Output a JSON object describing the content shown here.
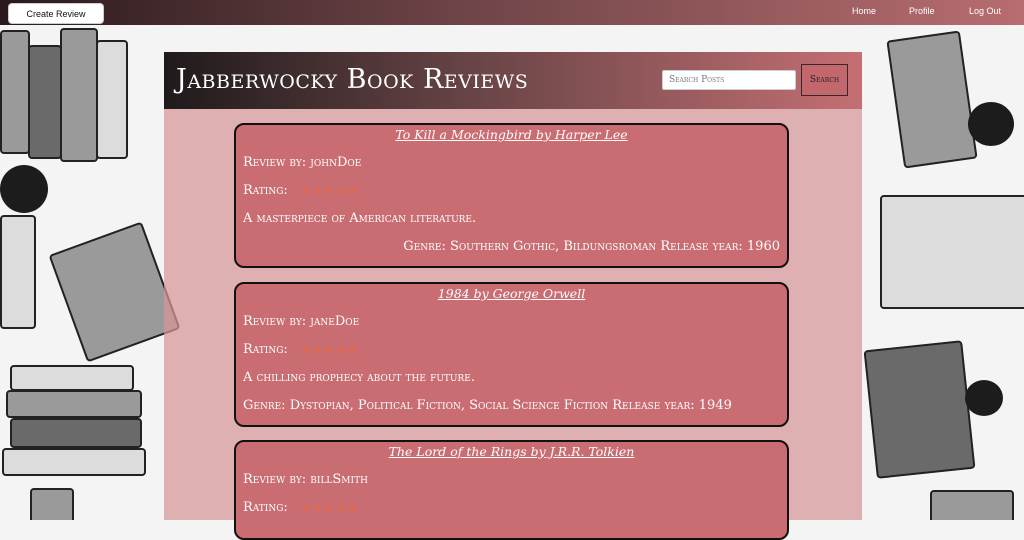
{
  "nav": {
    "create_label": "Create Review",
    "home_label": "Home",
    "profile_label": "Profile",
    "logout_label": "Log Out"
  },
  "header": {
    "title": "Jabberwocky Book Reviews",
    "search_placeholder": "Search Posts",
    "search_button": "Search"
  },
  "reviews": [
    {
      "title": "To Kill a Mockingbird by Harper Lee",
      "reviewer": "Review by: johnDoe",
      "rating_label": "Rating:",
      "stars": "★★★★★",
      "rating": 5,
      "body": "A masterpiece of American literature.",
      "footer": "Genre: Southern Gothic, Bildungsroman Release year: 1960"
    },
    {
      "title": "1984 by George Orwell",
      "reviewer": "Review by: janeDoe",
      "rating_label": "Rating:",
      "stars": "★★★★★",
      "rating": 5,
      "body": "A chilling prophecy about the future.",
      "footer": "Genre: Dystopian, Political Fiction, Social Science Fiction Release year: 1949"
    },
    {
      "title": "The Lord of the Rings by J.R.R. Tolkien",
      "reviewer": "Review by: billSmith",
      "rating_label": "Rating:",
      "stars": "★★★★★",
      "rating": 5
    }
  ],
  "colors": {
    "accent": "#c96d72",
    "star": "#e06a4e",
    "nav_start": "#2a1a1c",
    "nav_end": "#b86d70"
  }
}
